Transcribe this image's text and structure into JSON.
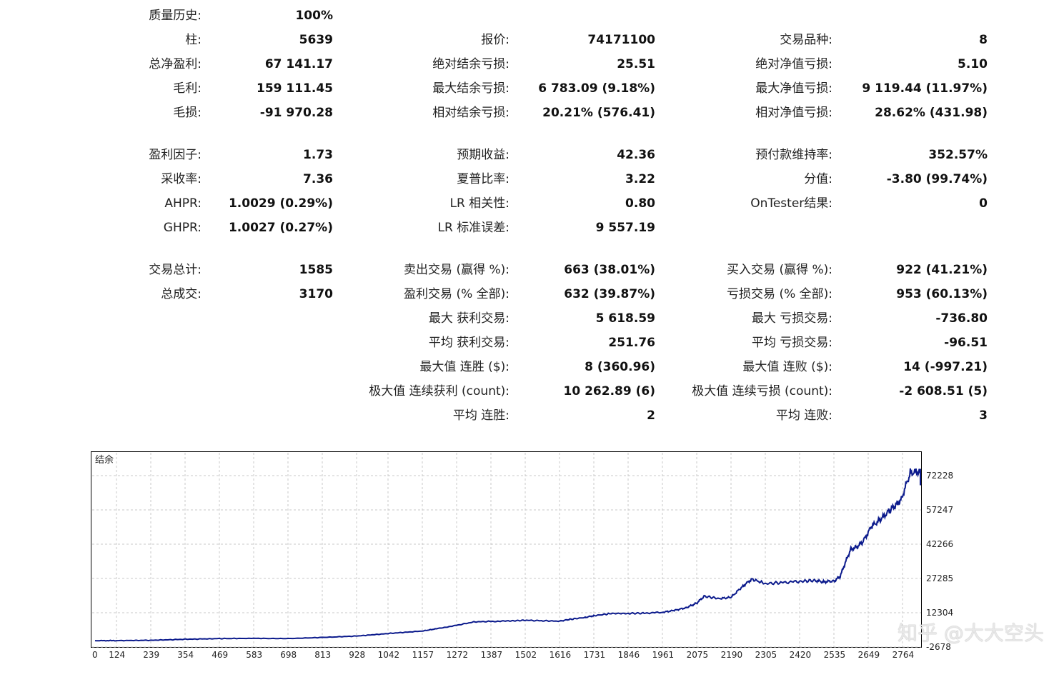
{
  "stats": [
    {
      "col": 0,
      "row": 0,
      "label": "质量历史:",
      "value": "100%"
    },
    {
      "col": 0,
      "row": 1,
      "label": "柱:",
      "value": "5639"
    },
    {
      "col": 0,
      "row": 2,
      "label": "总净盈利:",
      "value": "67 141.17"
    },
    {
      "col": 0,
      "row": 3,
      "label": "毛利:",
      "value": "159 111.45"
    },
    {
      "col": 0,
      "row": 4,
      "label": "毛损:",
      "value": "-91 970.28"
    },
    {
      "col": 0,
      "row": 5,
      "label": "盈利因子:",
      "value": "1.73"
    },
    {
      "col": 0,
      "row": 6,
      "label": "采收率:",
      "value": "7.36"
    },
    {
      "col": 0,
      "row": 7,
      "label": "AHPR:",
      "value": "1.0029 (0.29%)"
    },
    {
      "col": 0,
      "row": 8,
      "label": "GHPR:",
      "value": "1.0027 (0.27%)"
    },
    {
      "col": 0,
      "row": 9,
      "label": "交易总计:",
      "value": "1585"
    },
    {
      "col": 0,
      "row": 10,
      "label": "总成交:",
      "value": "3170"
    },
    {
      "col": 1,
      "row": 1,
      "label": "报价:",
      "value": "74171100"
    },
    {
      "col": 1,
      "row": 2,
      "label": "绝对结余亏损:",
      "value": "25.51"
    },
    {
      "col": 1,
      "row": 3,
      "label": "最大结余亏损:",
      "value": "6 783.09 (9.18%)"
    },
    {
      "col": 1,
      "row": 4,
      "label": "相对结余亏损:",
      "value": "20.21% (576.41)"
    },
    {
      "col": 1,
      "row": 5,
      "label": "预期收益:",
      "value": "42.36"
    },
    {
      "col": 1,
      "row": 6,
      "label": "夏普比率:",
      "value": "3.22"
    },
    {
      "col": 1,
      "row": 7,
      "label": "LR 相关性:",
      "value": "0.80"
    },
    {
      "col": 1,
      "row": 8,
      "label": "LR 标准误差:",
      "value": "9 557.19"
    },
    {
      "col": 1,
      "row": 9,
      "label": "卖出交易 (赢得 %):",
      "value": "663 (38.01%)"
    },
    {
      "col": 1,
      "row": 10,
      "label": "盈利交易 (% 全部):",
      "value": "632 (39.87%)"
    },
    {
      "col": 1,
      "row": 11,
      "label": "最大 获利交易:",
      "value": "5 618.59"
    },
    {
      "col": 1,
      "row": 12,
      "label": "平均 获利交易:",
      "value": "251.76"
    },
    {
      "col": 1,
      "row": 13,
      "label": "最大值 连胜 ($):",
      "value": "8 (360.96)"
    },
    {
      "col": 1,
      "row": 14,
      "label": "极大值 连续获利 (count):",
      "value": "10 262.89 (6)"
    },
    {
      "col": 1,
      "row": 15,
      "label": "平均 连胜:",
      "value": "2"
    },
    {
      "col": 2,
      "row": 1,
      "label": "交易品种:",
      "value": "8"
    },
    {
      "col": 2,
      "row": 2,
      "label": "绝对净值亏损:",
      "value": "5.10"
    },
    {
      "col": 2,
      "row": 3,
      "label": "最大净值亏损:",
      "value": "9 119.44 (11.97%)"
    },
    {
      "col": 2,
      "row": 4,
      "label": "相对净值亏损:",
      "value": "28.62% (431.98)"
    },
    {
      "col": 2,
      "row": 5,
      "label": "预付款维持率:",
      "value": "352.57%"
    },
    {
      "col": 2,
      "row": 6,
      "label": "分值:",
      "value": "-3.80 (99.74%)"
    },
    {
      "col": 2,
      "row": 7,
      "label": "OnTester结果:",
      "value": "0"
    },
    {
      "col": 2,
      "row": 9,
      "label": "买入交易 (赢得 %):",
      "value": "922 (41.21%)"
    },
    {
      "col": 2,
      "row": 10,
      "label": "亏损交易 (% 全部):",
      "value": "953 (60.13%)"
    },
    {
      "col": 2,
      "row": 11,
      "label": "最大 亏损交易:",
      "value": "-736.80"
    },
    {
      "col": 2,
      "row": 12,
      "label": "平均 亏损交易:",
      "value": "-96.51"
    },
    {
      "col": 2,
      "row": 13,
      "label": "最大值 连败 ($):",
      "value": "14 (-997.21)"
    },
    {
      "col": 2,
      "row": 14,
      "label": "极大值 连续亏损 (count):",
      "value": "-2 608.51 (5)"
    },
    {
      "col": 2,
      "row": 15,
      "label": "平均 连败:",
      "value": "3"
    }
  ],
  "chart_data": {
    "type": "line",
    "title": "结余",
    "x_ticks": [
      "0",
      "124",
      "239",
      "354",
      "469",
      "583",
      "698",
      "813",
      "928",
      "1042",
      "1157",
      "1272",
      "1387",
      "1502",
      "1616",
      "1731",
      "1846",
      "1961",
      "2075",
      "2190",
      "2305",
      "2420",
      "2535",
      "2649",
      "2764"
    ],
    "y_ticks": [
      "72228",
      "57247",
      "42266",
      "27285",
      "12304",
      "-2678"
    ],
    "xlim": [
      0,
      2870
    ],
    "ylim": [
      -4000,
      80000
    ],
    "grid": true,
    "line_color": "#0b1a8c",
    "series": [
      {
        "x": [
          0,
          124,
          239,
          354,
          469,
          583,
          698,
          813,
          928,
          1042,
          1157,
          1200,
          1272,
          1330,
          1387,
          1450,
          1502,
          1560,
          1616,
          1650,
          1700,
          1731,
          1780,
          1846,
          1900,
          1961,
          2000,
          2040,
          2075,
          2100,
          2150,
          2190,
          2230,
          2260,
          2305,
          2360,
          2420,
          2470,
          2500,
          2535,
          2555,
          2570,
          2590,
          2610,
          2630,
          2660,
          2690,
          2720,
          2740,
          2760,
          2790,
          2820,
          2845,
          2860,
          2870
        ],
        "values": [
          100,
          120,
          250,
          700,
          1000,
          1100,
          1000,
          1500,
          2100,
          3200,
          4300,
          5200,
          6800,
          8300,
          8500,
          8700,
          9000,
          8800,
          8600,
          9400,
          10200,
          11000,
          11800,
          12000,
          12100,
          12500,
          13300,
          14500,
          16500,
          19500,
          18500,
          19000,
          24000,
          27000,
          25000,
          25500,
          26000,
          26400,
          25800,
          26200,
          28000,
          33000,
          40000,
          41000,
          43000,
          50000,
          53000,
          57000,
          59000,
          62000,
          73500,
          74000,
          72000,
          71500,
          68000
        ]
      }
    ]
  },
  "watermark": "知乎 @大大空头"
}
